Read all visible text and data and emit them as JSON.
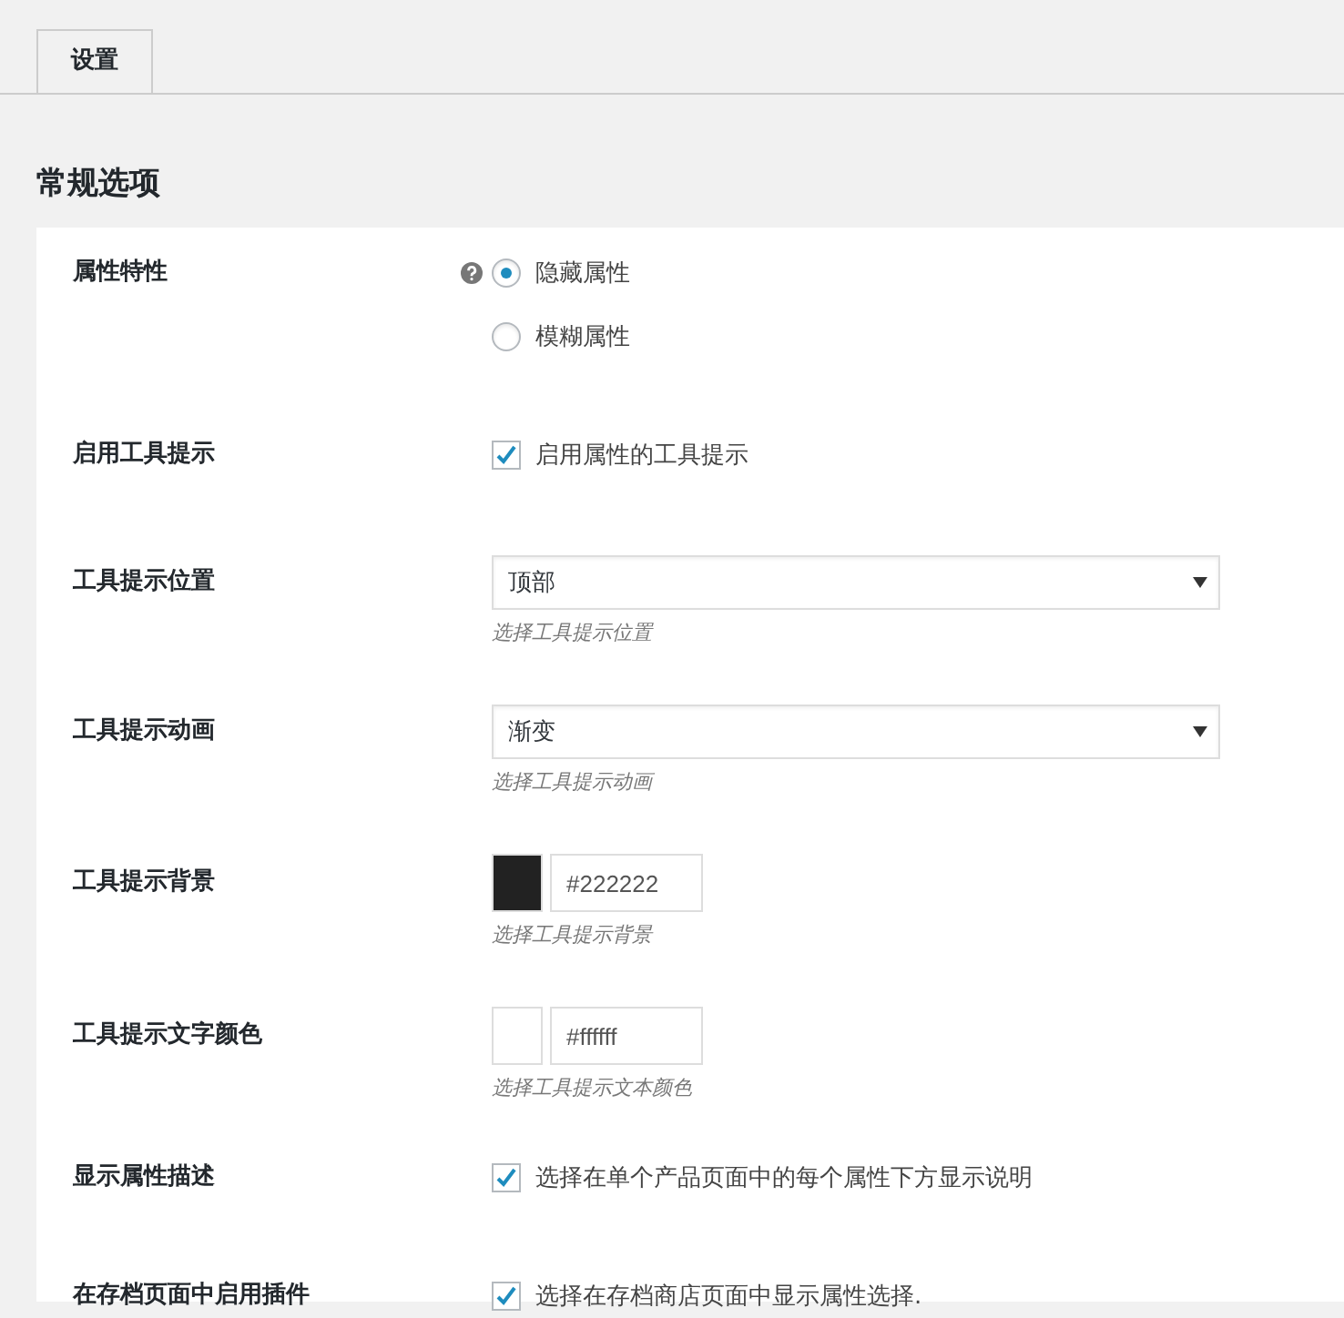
{
  "tabs": [
    {
      "label": "设置",
      "selected": true
    }
  ],
  "section_title": "常规选项",
  "settings": [
    {
      "kind": "radio",
      "label": "属性特性",
      "help": true,
      "options": [
        {
          "label": "隐藏属性",
          "selected": true
        },
        {
          "label": "模糊属性",
          "selected": false
        }
      ]
    },
    {
      "kind": "checkbox",
      "label": "启用工具提示",
      "checked": true,
      "text": "启用属性的工具提示"
    },
    {
      "kind": "select",
      "label": "工具提示位置",
      "value": "顶部",
      "description": "选择工具提示位置"
    },
    {
      "kind": "select",
      "label": "工具提示动画",
      "value": "渐变",
      "description": "选择工具提示动画"
    },
    {
      "kind": "color",
      "label": "工具提示背景",
      "color": "#222222",
      "value": "#222222",
      "description": "选择工具提示背景"
    },
    {
      "kind": "color",
      "label": "工具提示文字颜色",
      "color": "#ffffff",
      "value": "#ffffff",
      "description": "选择工具提示文本颜色"
    },
    {
      "kind": "checkbox",
      "label": "显示属性描述",
      "checked": true,
      "text": "选择在单个产品页面中的每个属性下方显示说明"
    },
    {
      "kind": "checkbox",
      "label": "在存档页面中启用插件",
      "checked": true,
      "text": "选择在存档商店页面中显示属性选择."
    }
  ]
}
